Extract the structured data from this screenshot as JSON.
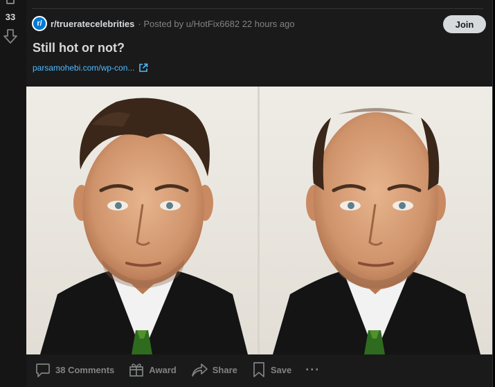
{
  "vote": {
    "count": "33"
  },
  "post": {
    "subreddit": "r/trueratecelebrities",
    "subreddit_icon": "r/",
    "meta": "· Posted by u/HotFix6682 22 hours ago",
    "join_label": "Join",
    "title": "Still hot or not?",
    "link": "parsamohebi.com/wp-con..."
  },
  "actions": {
    "comments": "38 Comments",
    "award": "Award",
    "share": "Share",
    "save": "Save",
    "more": "···"
  },
  "colors": {
    "background": "#1a1a1b",
    "text": "#d7dadc",
    "muted": "#818384",
    "link": "#4fbcff",
    "brand": "#0079d3"
  }
}
